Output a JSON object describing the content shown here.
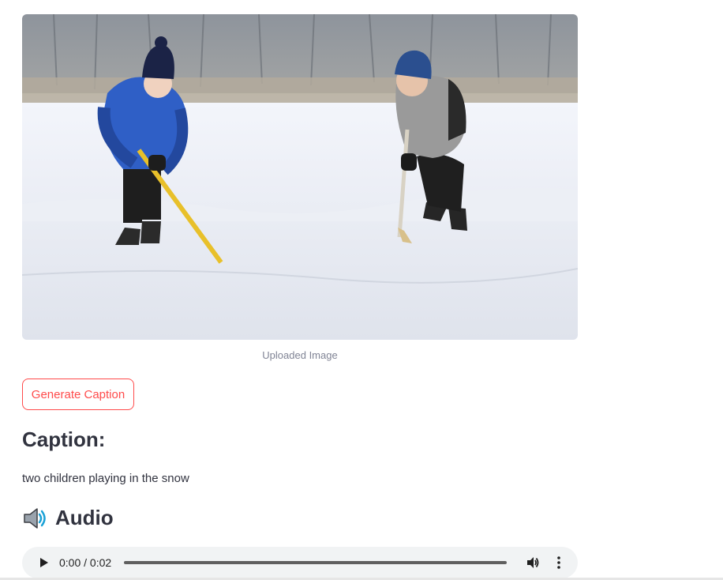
{
  "image": {
    "caption": "Uploaded Image",
    "icon": "photo-of-children-ice-skating"
  },
  "actions": {
    "generate_label": "Generate Caption"
  },
  "result": {
    "heading": "Caption:",
    "text": "two children playing in the snow"
  },
  "audio": {
    "heading": "Audio",
    "heading_icon": "speaker-icon",
    "current_time": "0:00",
    "separator": " / ",
    "duration": "0:02",
    "progress": 0
  },
  "colors": {
    "accent": "#ff4b4b",
    "text": "#31333f",
    "muted": "#808495",
    "player_bg": "#f1f3f4"
  }
}
